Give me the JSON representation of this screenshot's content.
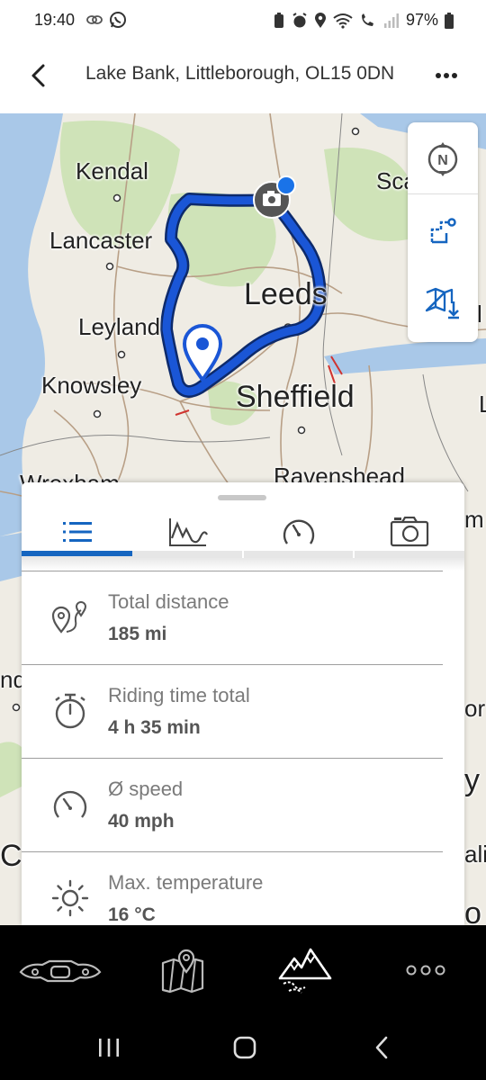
{
  "status_bar": {
    "time": "19:40",
    "battery": "97%"
  },
  "header": {
    "title": "Lake Bank, Littleborough, OL15 0DN",
    "back_icon": "back-arrow-icon",
    "more_icon": "more-horizontal-icon"
  },
  "map": {
    "labels": {
      "kendal": "Kendal",
      "lancaster": "Lancaster",
      "leyland": "Leyland",
      "knowsley": "Knowsley",
      "leeds": "Leeds",
      "sheffield": "Sheffield",
      "ravenshead": "Ravenshead",
      "wrexham": "Wrexham",
      "sca": "Sca",
      "right_l": "l",
      "right_L": "L",
      "right_m": "m",
      "left_nd": "nd",
      "right_or": "or",
      "right_y": "y",
      "left_ca": "Ca",
      "right_ali": "ali",
      "right_o": "o"
    },
    "controls": [
      "compass-north-icon",
      "route-points-icon",
      "offline-map-download-icon"
    ]
  },
  "sheet": {
    "tabs": [
      {
        "icon": "list-icon",
        "active": true
      },
      {
        "icon": "elevation-profile-icon",
        "active": false
      },
      {
        "icon": "speedometer-icon",
        "active": false
      },
      {
        "icon": "camera-icon",
        "active": false
      }
    ],
    "stats": [
      {
        "label": "Total distance",
        "value": "185 mi",
        "icon": "route-distance-icon"
      },
      {
        "label": "Riding time total",
        "value": "4 h 35 min",
        "icon": "stopwatch-icon"
      },
      {
        "label": "Ø speed",
        "value": "40 mph",
        "icon": "speed-gauge-icon"
      },
      {
        "label": "Max. temperature",
        "value": "16 °C",
        "icon": "sun-icon"
      }
    ]
  },
  "bottom_nav": {
    "items": [
      {
        "icon": "motorcycle-dashboard-icon",
        "active": false
      },
      {
        "icon": "map-pin-icon",
        "active": false
      },
      {
        "icon": "mountain-routes-icon",
        "active": true
      },
      {
        "icon": "more-dots-icon",
        "active": false
      }
    ]
  },
  "colors": {
    "accent": "#1565c0",
    "route": "#1a56d6",
    "map_green": "#cfe3b8",
    "water": "#a9c8e8",
    "land": "#efece4"
  }
}
